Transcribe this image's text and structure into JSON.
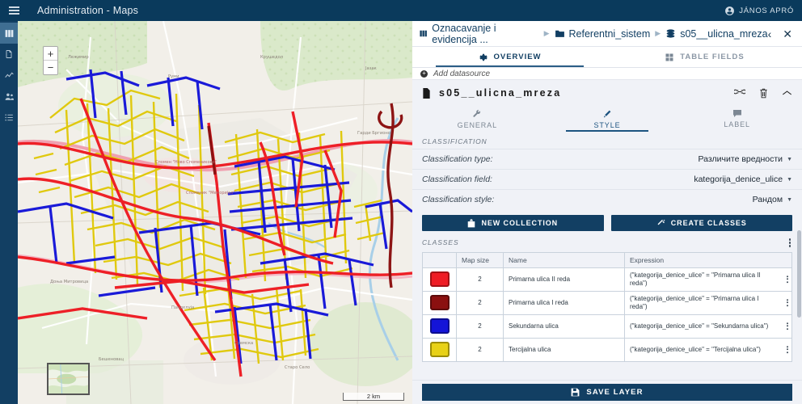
{
  "topbar": {
    "menu_icon": "hamburger-icon",
    "title": "Administration - Maps",
    "user": "JÁNOS APRÓ",
    "user_icon": "account-circle-icon",
    "bg": "#0a3a5c"
  },
  "rail": {
    "items": [
      {
        "icon": "map-book-icon",
        "name": "maps",
        "active": true
      },
      {
        "icon": "document-icon",
        "name": "documents",
        "active": false
      },
      {
        "icon": "analytics-chart-icon",
        "name": "analytics",
        "active": false
      },
      {
        "icon": "users-icon",
        "name": "users",
        "active": false
      },
      {
        "icon": "list-icon",
        "name": "lists",
        "active": false
      }
    ]
  },
  "map": {
    "zoom_in": "+",
    "zoom_out": "−",
    "scale_label": "2 km",
    "street_colors": {
      "primary_ii": "#ee1c24",
      "primary_i": "#8b1010",
      "secondary": "#1414d8",
      "tertiary": "#e0c808"
    }
  },
  "panel": {
    "breadcrumb": [
      {
        "icon": "book-icon",
        "label": "Oznacavanje i evidencija ..."
      },
      {
        "icon": "folder-icon",
        "label": "Referentni_sistem"
      },
      {
        "icon": "layers-stack-icon",
        "label": "s05__ulicna_mreza"
      }
    ],
    "collapse_icon": "chevron-left-icon",
    "close_icon": "close-icon",
    "tabs": [
      {
        "icon": "gear-icon",
        "label": "OVERVIEW",
        "active": true
      },
      {
        "icon": "grid-icon",
        "label": "TABLE FIELDS",
        "active": false
      }
    ],
    "add_datasource": "Add datasource",
    "layer": {
      "icon": "layer-file-icon",
      "name": "s05__ulicna_mreza",
      "actions": [
        "link-icon",
        "trash-icon",
        "chevron-up-icon"
      ]
    },
    "subtabs": [
      {
        "icon": "wrench-icon",
        "label": "GENERAL",
        "active": false
      },
      {
        "icon": "brush-icon",
        "label": "STYLE",
        "active": true
      },
      {
        "icon": "comment-icon",
        "label": "LABEL",
        "active": false
      }
    ],
    "classification": {
      "section_title": "CLASSIFICATION",
      "rows": [
        {
          "label": "Classification type:",
          "value": "Различите вредности"
        },
        {
          "label": "Classification field:",
          "value": "kategorija_denice_ulice"
        },
        {
          "label": "Classification style:",
          "value": "Рандом"
        }
      ]
    },
    "buttons": [
      {
        "icon": "collection-icon",
        "label": "NEW COLLECTION"
      },
      {
        "icon": "wand-icon",
        "label": "CREATE CLASSES"
      }
    ],
    "classes": {
      "title": "CLASSES",
      "menu_icon": "kebab-menu-icon",
      "columns": [
        "",
        "Map size",
        "Name",
        "Expression"
      ],
      "rows": [
        {
          "color": "#ee1c24",
          "border": "#a31014",
          "map_size": "2",
          "name": "Primarna ulica II reda",
          "expression": "(\"kategorija_denice_ulice\" = \"Primarna ulica II reda\")"
        },
        {
          "color": "#8b1010",
          "border": "#5c0a0a",
          "map_size": "2",
          "name": "Primarna ulica I reda",
          "expression": "(\"kategorija_denice_ulice\" = \"Primarna ulica I reda\")"
        },
        {
          "color": "#1414d8",
          "border": "#0d0d8f",
          "map_size": "2",
          "name": "Sekundarna ulica",
          "expression": "(\"kategorija_denice_ulice\" = \"Sekundarna ulica\")"
        },
        {
          "color": "#e8d117",
          "border": "#9c8c06",
          "map_size": "2",
          "name": "Tercijalna ulica",
          "expression": "(\"kategorija_denice_ulice\" = \"Tercijalna ulica\")"
        }
      ]
    },
    "save": {
      "icon": "save-disk-icon",
      "label": "SAVE LAYER"
    }
  }
}
